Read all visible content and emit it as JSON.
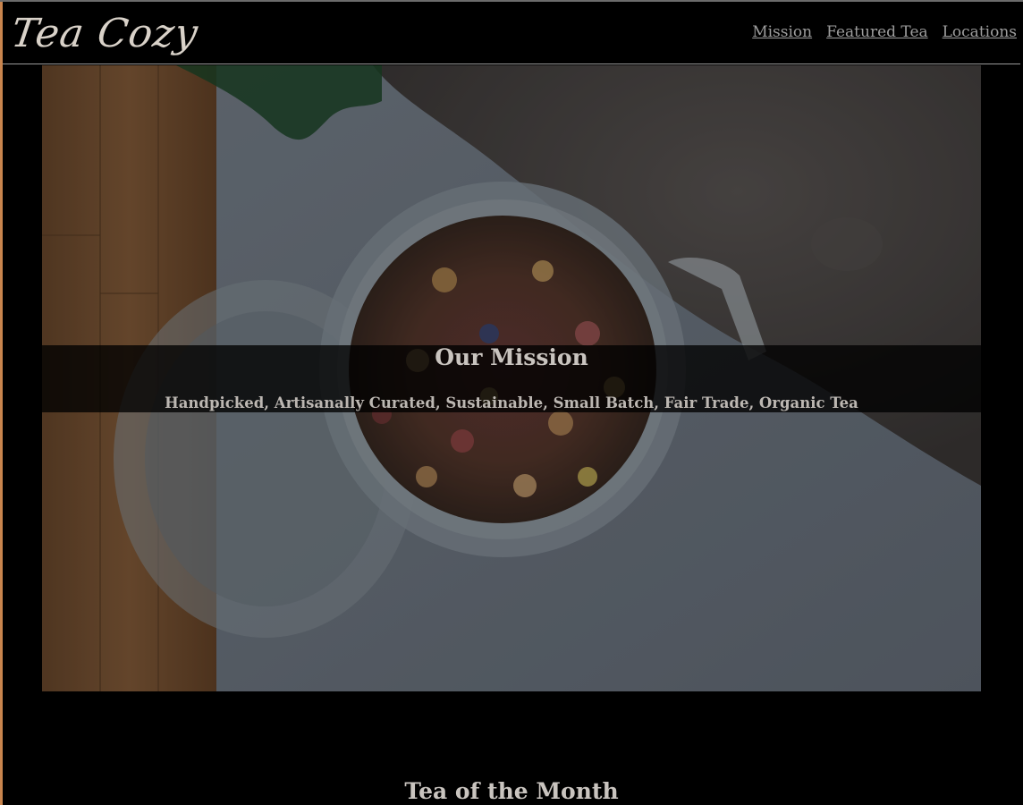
{
  "header": {
    "logo": "Tea Cozy",
    "nav": [
      {
        "label": "Mission"
      },
      {
        "label": "Featured Tea"
      },
      {
        "label": "Locations"
      }
    ]
  },
  "hero": {
    "image": "loose-leaf-tea-jar-photo",
    "title": "Our Mission",
    "tagline": "Handpicked, Artisanally Curated, Sustainable, Small Batch, Fair Trade, Organic Tea"
  },
  "tea_section": {
    "title": "Tea of the Month"
  },
  "colors": {
    "background": "#000000",
    "text": "#c9c4bf",
    "nav_link": "#9d9d9d",
    "accent_edge": "#c9854e"
  }
}
